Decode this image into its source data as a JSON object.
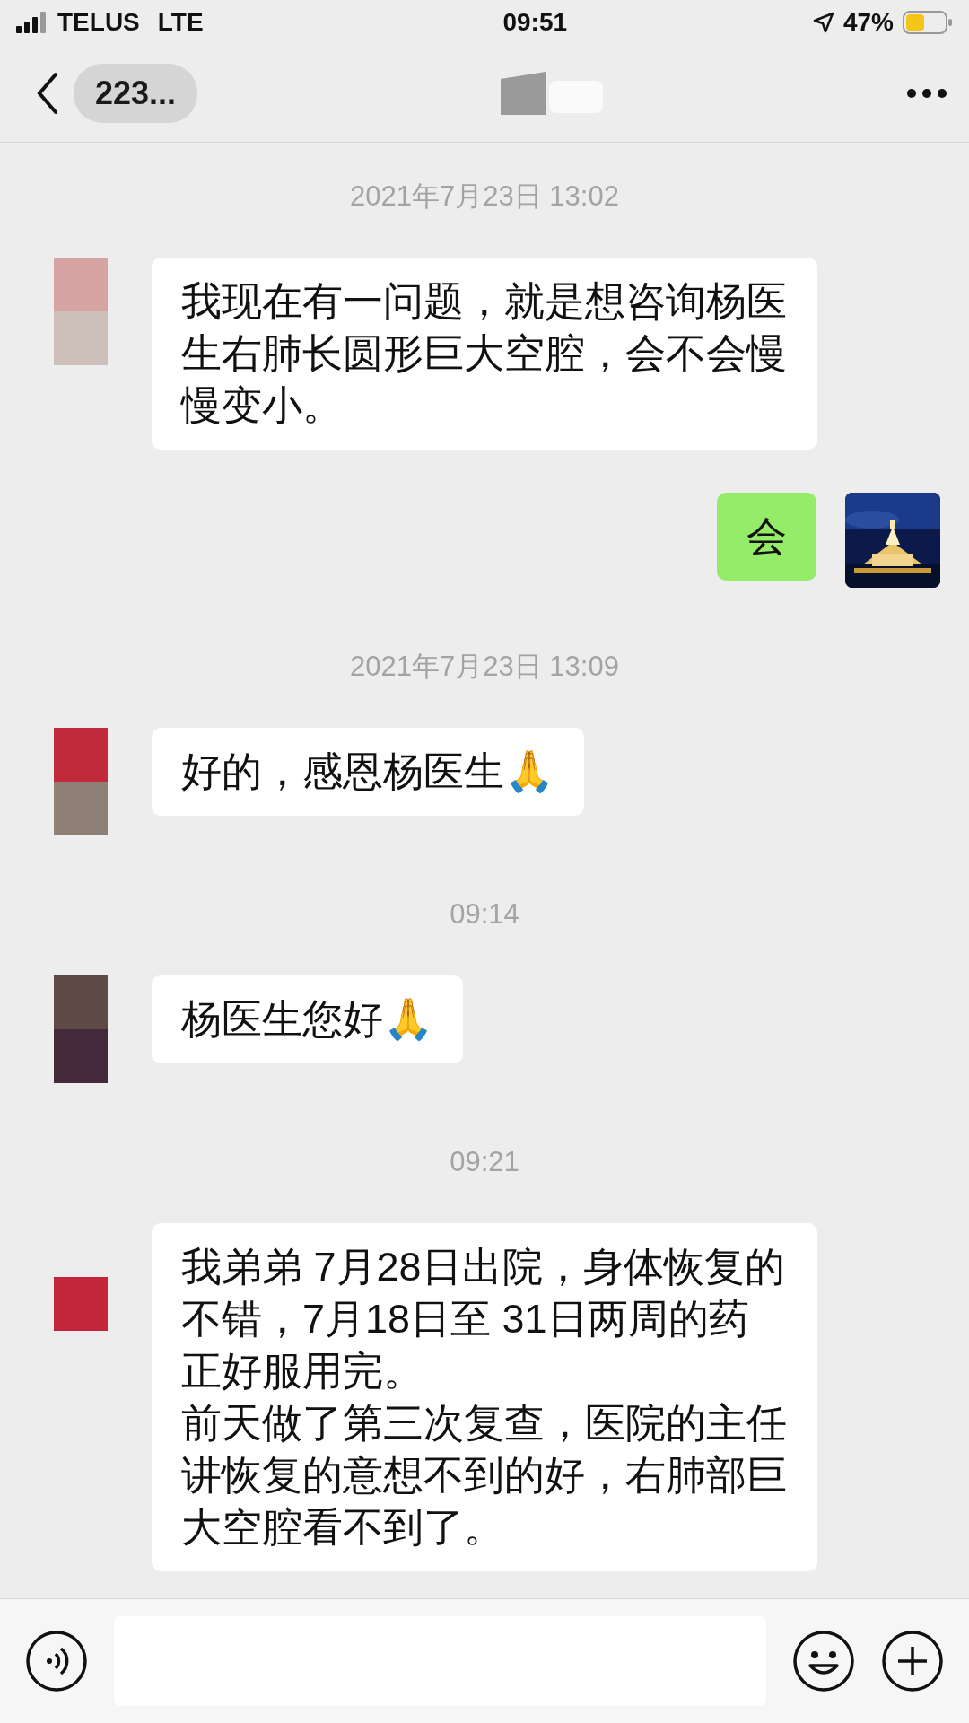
{
  "status_bar": {
    "carrier": "TELUS",
    "network": "LTE",
    "time": "09:51",
    "battery": "47%"
  },
  "nav": {
    "title": "223..."
  },
  "messages": [
    {
      "kind": "timestamp",
      "text": "2021年7月23日 13:02"
    },
    {
      "kind": "incoming",
      "paragraphs": [
        "我现在有一问题，就是想咨询杨医生右肺长圆形巨大空腔，会不会慢慢变小。"
      ]
    },
    {
      "kind": "outgoing",
      "paragraphs": [
        "会"
      ]
    },
    {
      "kind": "timestamp",
      "text": "2021年7月23日 13:09"
    },
    {
      "kind": "incoming",
      "paragraphs": [
        "好的，感恩杨医生🙏"
      ]
    },
    {
      "kind": "timestamp",
      "text": "09:14"
    },
    {
      "kind": "incoming",
      "paragraphs": [
        "杨医生您好🙏"
      ]
    },
    {
      "kind": "timestamp",
      "text": "09:21"
    },
    {
      "kind": "incoming",
      "paragraphs": [
        "我弟弟 7月28日出院，身体恢复的不错，7月18日至 31日两周的药正好服用完。",
        "前天做了第三次复查，医院的主任讲恢复的意想不到的好，右肺部巨大空腔看不到了。"
      ]
    }
  ]
}
